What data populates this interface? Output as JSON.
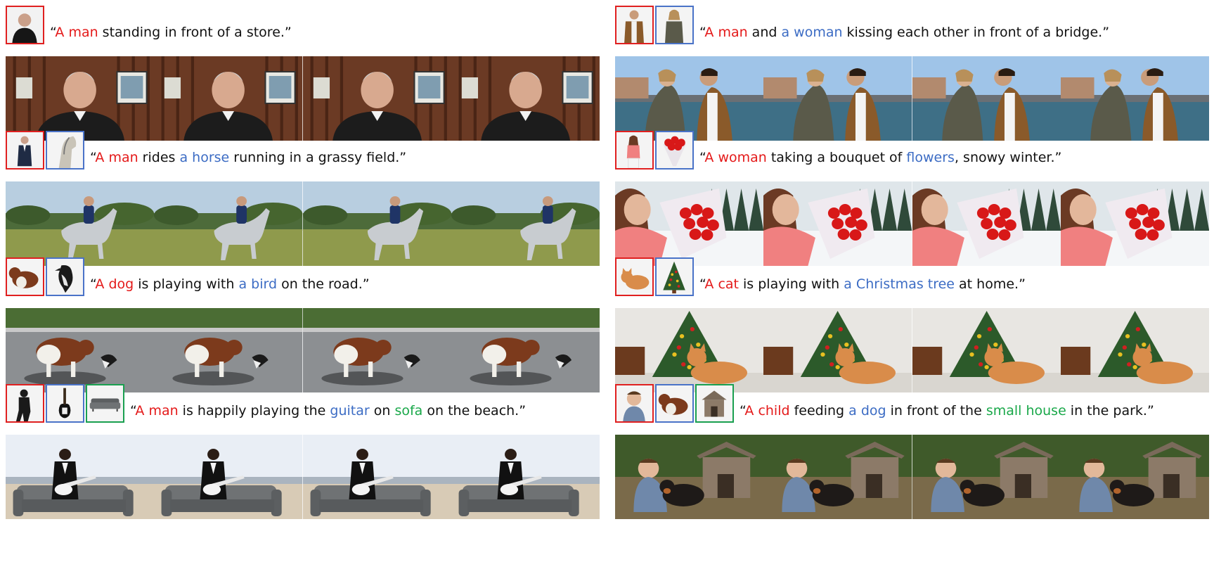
{
  "rows": [
    {
      "refs": [
        {
          "color": "red",
          "icon": "man-portrait-icon"
        }
      ],
      "caption": [
        {
          "t": "“",
          "c": ""
        },
        {
          "t": "A man",
          "c": "red"
        },
        {
          "t": " standing in front of a store.”",
          "c": ""
        }
      ],
      "scene": "store"
    },
    {
      "refs": [
        {
          "color": "red",
          "icon": "man-suit-icon"
        },
        {
          "color": "blue",
          "icon": "horse-icon"
        }
      ],
      "caption": [
        {
          "t": "“",
          "c": ""
        },
        {
          "t": "A man",
          "c": "red"
        },
        {
          "t": " rides ",
          "c": ""
        },
        {
          "t": "a horse",
          "c": "blue"
        },
        {
          "t": " running in a grassy field.”",
          "c": ""
        }
      ],
      "scene": "field"
    },
    {
      "refs": [
        {
          "color": "red",
          "icon": "dog-icon"
        },
        {
          "color": "blue",
          "icon": "bird-icon"
        }
      ],
      "caption": [
        {
          "t": "“",
          "c": ""
        },
        {
          "t": "A dog",
          "c": "red"
        },
        {
          "t": " is playing with ",
          "c": ""
        },
        {
          "t": "a bird",
          "c": "blue"
        },
        {
          "t": " on the road.”",
          "c": ""
        }
      ],
      "scene": "road"
    },
    {
      "refs": [
        {
          "color": "red",
          "icon": "man-silhouette-icon"
        },
        {
          "color": "blue",
          "icon": "guitar-icon"
        },
        {
          "color": "green",
          "icon": "sofa-icon"
        }
      ],
      "caption": [
        {
          "t": "“",
          "c": ""
        },
        {
          "t": "A man",
          "c": "red"
        },
        {
          "t": " is happily playing the ",
          "c": ""
        },
        {
          "t": "guitar",
          "c": "blue"
        },
        {
          "t": " on ",
          "c": ""
        },
        {
          "t": "sofa",
          "c": "green"
        },
        {
          "t": " on the beach.”",
          "c": ""
        }
      ],
      "scene": "beach"
    },
    {
      "refs": [
        {
          "color": "red",
          "icon": "man-jacket-icon"
        },
        {
          "color": "blue",
          "icon": "woman-icon"
        }
      ],
      "caption": [
        {
          "t": "“",
          "c": ""
        },
        {
          "t": "A man",
          "c": "red"
        },
        {
          "t": " and ",
          "c": ""
        },
        {
          "t": "a woman",
          "c": "blue"
        },
        {
          "t": " kissing each other in front of a bridge.”",
          "c": ""
        }
      ],
      "scene": "bridge"
    },
    {
      "refs": [
        {
          "color": "red",
          "icon": "woman-pink-icon"
        },
        {
          "color": "blue",
          "icon": "bouquet-icon"
        }
      ],
      "caption": [
        {
          "t": "“",
          "c": ""
        },
        {
          "t": "A woman",
          "c": "red"
        },
        {
          "t": " taking a bouquet of ",
          "c": ""
        },
        {
          "t": "flowers",
          "c": "blue"
        },
        {
          "t": ", snowy winter.”",
          "c": ""
        }
      ],
      "scene": "snow"
    },
    {
      "refs": [
        {
          "color": "red",
          "icon": "cat-icon"
        },
        {
          "color": "blue",
          "icon": "christmas-tree-icon"
        }
      ],
      "caption": [
        {
          "t": "“",
          "c": ""
        },
        {
          "t": "A cat",
          "c": "red"
        },
        {
          "t": " is playing with ",
          "c": ""
        },
        {
          "t": "a Christmas tree",
          "c": "blue"
        },
        {
          "t": " at home.”",
          "c": ""
        }
      ],
      "scene": "christmas"
    },
    {
      "refs": [
        {
          "color": "red",
          "icon": "child-icon"
        },
        {
          "color": "blue",
          "icon": "dog-icon"
        },
        {
          "color": "green",
          "icon": "dog-house-icon"
        }
      ],
      "caption": [
        {
          "t": "“",
          "c": ""
        },
        {
          "t": "A child",
          "c": "red"
        },
        {
          "t": " feeding ",
          "c": ""
        },
        {
          "t": "a dog",
          "c": "blue"
        },
        {
          "t": " in front of the ",
          "c": ""
        },
        {
          "t": "small house",
          "c": "green"
        },
        {
          "t": " in the park.”",
          "c": ""
        }
      ],
      "scene": "park"
    }
  ],
  "colors": {
    "red": "#e41a1a",
    "blue": "#3c6cc4",
    "green": "#1aa84a"
  }
}
